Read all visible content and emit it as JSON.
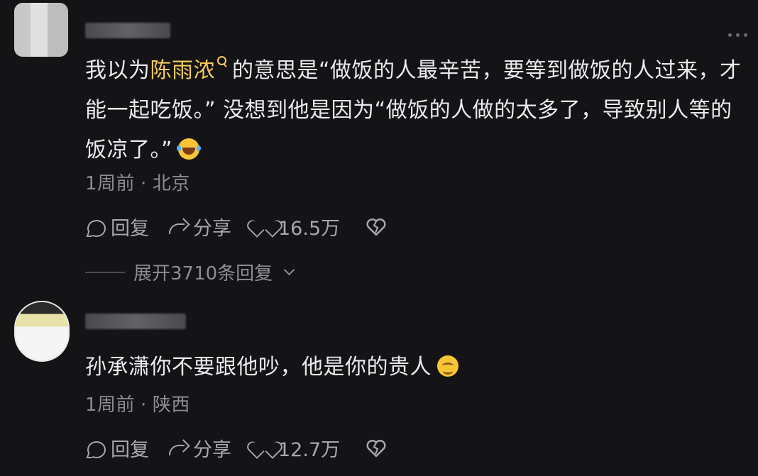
{
  "comments": [
    {
      "text_before_mention": "我以为",
      "mention": "陈雨浓",
      "text_lines": "的意思是“做饭的人最辛苦，要等到做饭的人过来，才能一起吃饭。”  没想到他是因为“做饭的人做的太多了，导致别人等的饭凉了。”",
      "emoji": "laughing-crying-emoji",
      "time": "1周前",
      "separator": "·",
      "location": "北京",
      "reply_label": "回复",
      "share_label": "分享",
      "likes": "16.5万",
      "expand_label": "展开3710条回复"
    },
    {
      "text": "孙承潇你不要跟他吵，他是你的贵人",
      "emoji": "smiling-emoji",
      "time": "1周前",
      "separator": "·",
      "location": "陕西",
      "reply_label": "回复",
      "share_label": "分享",
      "likes": "12.7万"
    }
  ],
  "colors": {
    "background": "#141416",
    "mention": "#f4c95d",
    "meta": "#8c8c91"
  }
}
